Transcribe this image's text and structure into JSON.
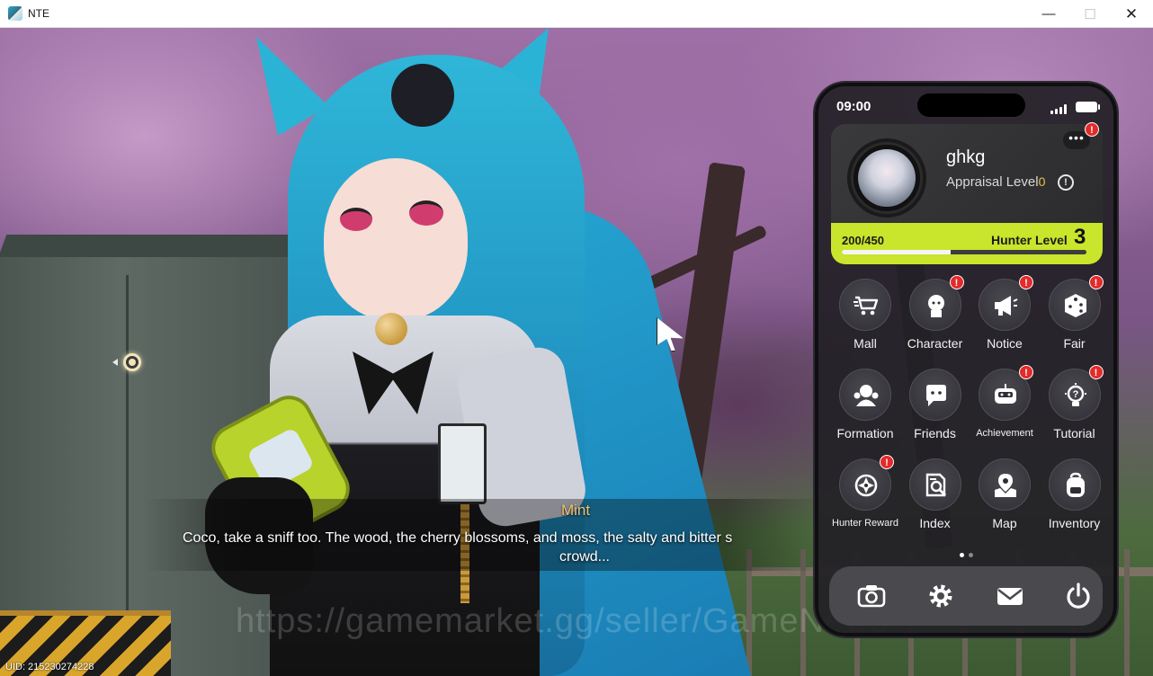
{
  "window": {
    "title": "NTE",
    "minimize_glyph": "—",
    "maximize_glyph": "☐",
    "close_glyph": "✕"
  },
  "scene": {
    "speaker": "Mint",
    "dialogue_line1": "Coco, take a sniff too. The wood, the cherry blossoms, and moss, the salty and bitter s",
    "dialogue_line2": "crowd...",
    "watermark": "https://gamemarket.gg/seller/GameNews",
    "uid": "UID: 215230274228"
  },
  "phone": {
    "time": "09:00",
    "profile": {
      "name": "ghkg",
      "appraisal_label": "Appraisal Level",
      "appraisal_level": "0",
      "more_glyph": "•••",
      "info_glyph": "!",
      "exp_text": "200/450",
      "exp_fraction": 0.444,
      "hunter_label": "Hunter Level",
      "hunter_level": "3",
      "badge": "!"
    },
    "menu": [
      {
        "label": "Mall",
        "icon": "cart-icon",
        "badge": ""
      },
      {
        "label": "Character",
        "icon": "character-icon",
        "badge": "!"
      },
      {
        "label": "Notice",
        "icon": "megaphone-icon",
        "badge": "!"
      },
      {
        "label": "Fair",
        "icon": "dice-icon",
        "badge": "!"
      },
      {
        "label": "Formation",
        "icon": "formation-icon",
        "badge": ""
      },
      {
        "label": "Friends",
        "icon": "chat-bubble-icon",
        "badge": ""
      },
      {
        "label": "Achievement",
        "icon": "robot-icon",
        "badge": "!"
      },
      {
        "label": "Tutorial",
        "icon": "lightbulb-icon",
        "badge": "!"
      },
      {
        "label": "Hunter Reward",
        "icon": "target-icon",
        "badge": "!"
      },
      {
        "label": "Index",
        "icon": "magnify-document-icon",
        "badge": ""
      },
      {
        "label": "Map",
        "icon": "map-pin-icon",
        "badge": ""
      },
      {
        "label": "Inventory",
        "icon": "backpack-icon",
        "badge": ""
      }
    ],
    "page_count": 2,
    "active_page": 1,
    "dock": [
      "camera-icon",
      "settings-gear-icon",
      "mail-icon",
      "power-icon"
    ]
  },
  "colors": {
    "accent_lime": "#c9e52c",
    "badge_red": "#e42a2a",
    "speaker_gold": "#f0c477",
    "appraisal_gold": "#e3c24d"
  }
}
